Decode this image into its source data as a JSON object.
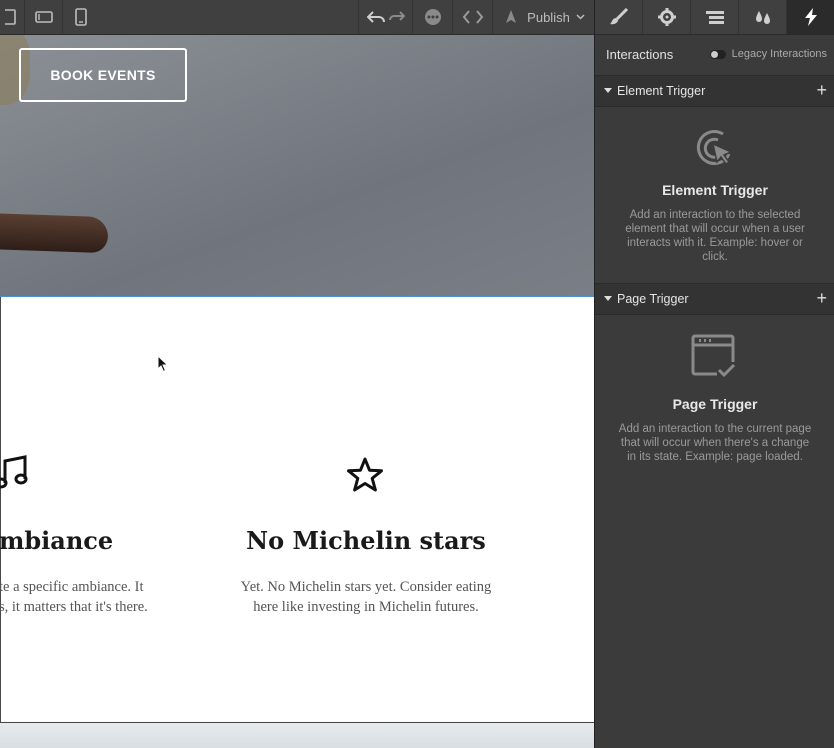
{
  "toolbar": {
    "publish_label": "Publish",
    "icons": [
      "desktop-icon",
      "tablet-landscape-icon",
      "mobile-icon",
      "undo-icon",
      "redo-icon",
      "more-icon",
      "code-icon",
      "publish-rocket-icon",
      "chevron-down-icon"
    ]
  },
  "canvas": {
    "hero_button_label": "BOOK EVENTS",
    "features": [
      {
        "title": "mbiance",
        "text_line1": "te a specific ambiance. It",
        "text_line2": "s, it matters that it's there.",
        "icon": "music-note-icon"
      },
      {
        "title": "No Michelin stars",
        "text_line1": "Yet. No Michelin stars yet. Consider eating",
        "text_line2": "here like investing in Michelin futures.",
        "icon": "star-icon"
      }
    ]
  },
  "panel": {
    "tabs": [
      "style-brush-icon",
      "settings-gear-icon",
      "navigator-icon",
      "style-manager-drops-icon",
      "interactions-bolt-icon"
    ],
    "title": "Interactions",
    "legacy_label": "Legacy Interactions",
    "element_trigger": {
      "section_label": "Element Trigger",
      "title": "Element Trigger",
      "description": "Add an interaction to the selected element that will occur when a user interacts with it. Example: hover or click."
    },
    "page_trigger": {
      "section_label": "Page Trigger",
      "title": "Page Trigger",
      "description": "Add an interaction to the current page that will occur when there's a change in its state. Example: page loaded."
    }
  },
  "colors": {
    "panel_bg": "#3b3b3b",
    "toolbar_bg": "#404040",
    "selection_blue": "#4a90d9"
  }
}
